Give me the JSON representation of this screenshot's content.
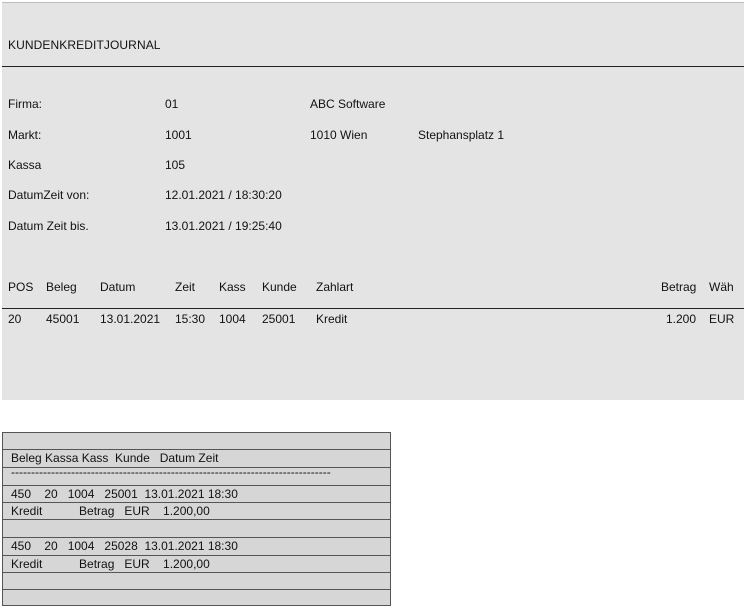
{
  "report": {
    "title": "KUNDENKREDITJOURNAL",
    "fields": {
      "firma_label": "Firma:",
      "firma_value": "01",
      "firma_name": "ABC Software",
      "markt_label": "Markt:",
      "markt_value": "1001",
      "markt_city": "1010 Wien",
      "markt_street": "Stephansplatz 1",
      "kassa_label": "Kassa",
      "kassa_value": "105",
      "von_label": "DatumZeit von:",
      "von_value": "12.01.2021 / 18:30:20",
      "bis_label": "Datum Zeit bis.",
      "bis_value": "13.01.2021 / 19:25:40"
    },
    "columns": {
      "pos": "POS",
      "beleg": "Beleg",
      "datum": "Datum",
      "zeit": "Zeit",
      "kass": "Kass",
      "kunde": "Kunde",
      "zahlart": "Zahlart",
      "betrag": "Betrag",
      "waeh": "Wäh"
    },
    "rows": [
      {
        "pos": "20",
        "beleg": "45001",
        "datum": "13.01.2021",
        "zeit": "15:30",
        "kass": "1004",
        "kunde": "25001",
        "zahlart": "Kredit",
        "betrag": "1.200",
        "waeh": "EUR"
      }
    ]
  },
  "receipt": {
    "rows": [
      "",
      "Beleg Kassa Kass  Kunde   Datum Zeit",
      "--------------------------------------------------------------------------------",
      "450    20   1004   25001  13.01.2021 18:30",
      "Kredit           Betrag   EUR    1.200,00",
      "",
      "450    20   1004   25028  13.01.2021 18:30",
      "Kredit           Betrag   EUR    1.200,00",
      "",
      ""
    ]
  }
}
